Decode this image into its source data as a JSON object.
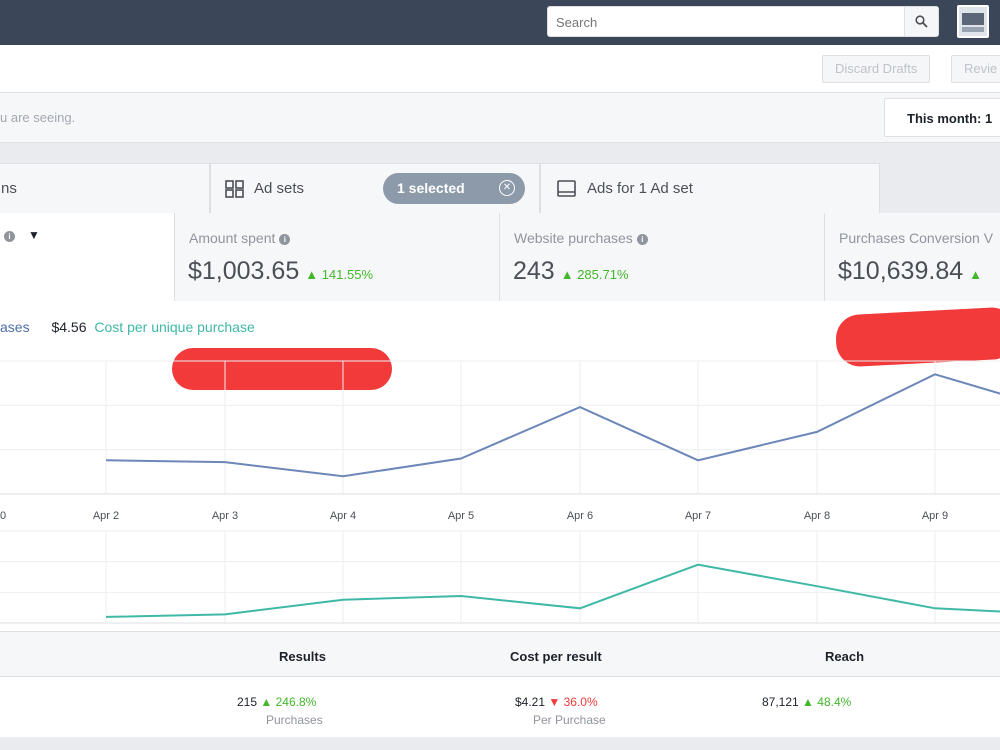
{
  "search": {
    "placeholder": "Search"
  },
  "toolbar": {
    "discard_label": "Discard Drafts",
    "review_label": "Revie"
  },
  "filterbar": {
    "hint": "u are seeing.",
    "date_label": "This month: 1"
  },
  "tabs": {
    "campaigns_label": "ns",
    "adsets_label": "Ad sets",
    "selected_label": "1 selected",
    "ads_label": "Ads for 1 Ad set"
  },
  "metrics": [
    {
      "title": "Amount spent",
      "value": "$1,003.65",
      "change": "141.55%"
    },
    {
      "title": "Website purchases",
      "value": "243",
      "change": "285.71%"
    },
    {
      "title": "Purchases Conversion V",
      "value": "$10,639.84",
      "change": ""
    }
  ],
  "legend": {
    "series1": "ases",
    "cost_value": "$4.56",
    "series2": "Cost per unique purchase"
  },
  "colors": {
    "accent_blue": "#6c87b8",
    "accent_teal": "#3fb8a6",
    "positive": "#42b72a",
    "negative": "#f23a3a"
  },
  "chart_data": {
    "type": "line",
    "x": [
      "Apr 2",
      "Apr 3",
      "Apr 4",
      "Apr 5",
      "Apr 6",
      "Apr 7",
      "Apr 8",
      "Apr 9"
    ],
    "x_cut_label": "0",
    "series": [
      {
        "values": [
          0.38,
          0.36,
          0.2,
          0.4,
          0.98,
          0.38,
          0.7,
          1.35
        ]
      },
      {
        "values": [
          0.1,
          0.14,
          0.38,
          0.44,
          0.24,
          0.95,
          0.6,
          0.24
        ]
      }
    ]
  },
  "table": {
    "headers": {
      "results": "Results",
      "cost": "Cost per result",
      "reach": "Reach"
    },
    "row": {
      "results": "215",
      "results_change": "246.8%",
      "results_sub": "Purchases",
      "cost": "$4.21",
      "cost_change": "36.0%",
      "cost_sub": "Per Purchase",
      "reach": "87,121",
      "reach_change": "48.4%"
    }
  }
}
